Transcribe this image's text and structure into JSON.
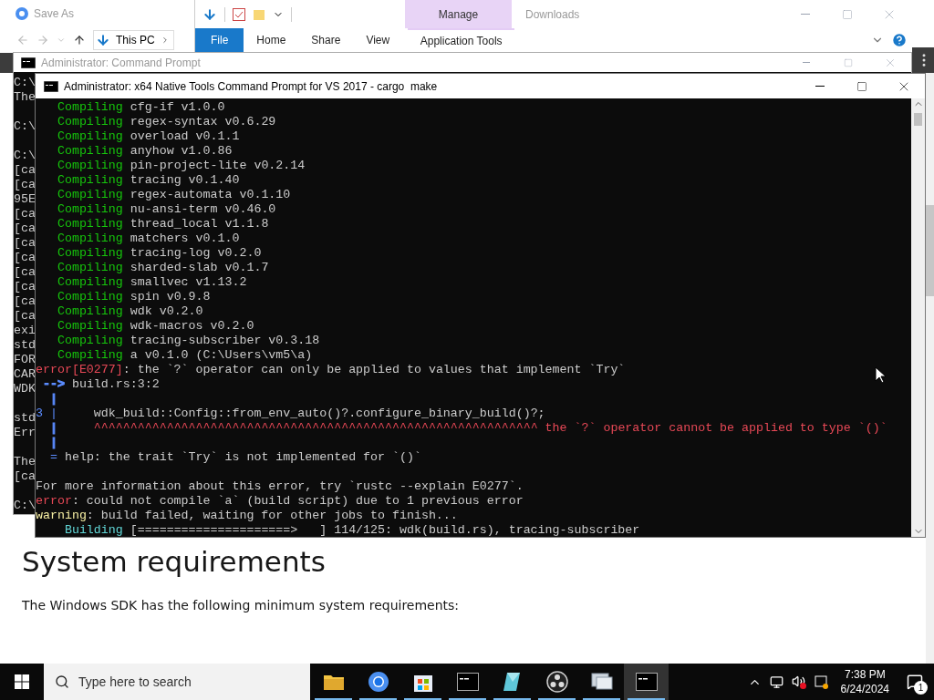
{
  "browser": {
    "heading": "System requirements",
    "paragraph": "The Windows SDK has the following minimum system requirements:"
  },
  "save_as_dialog": {
    "title": "Save As",
    "path": [
      "This PC"
    ]
  },
  "explorer": {
    "title": "Downloads",
    "context_tab": "Manage",
    "ribbon_tabs": [
      {
        "label": "File",
        "kind": "file"
      },
      {
        "label": "Home",
        "kind": "tab"
      },
      {
        "label": "Share",
        "kind": "tab"
      },
      {
        "label": "View",
        "kind": "tab"
      },
      {
        "label": "Application Tools",
        "kind": "context"
      }
    ]
  },
  "background_cmd": {
    "title": "Administrator: Command Prompt",
    "lines": [
      {
        "kind": "text",
        "text": "C:\\"
      },
      {
        "kind": "text",
        "text": "The"
      },
      {
        "kind": "blank"
      },
      {
        "kind": "text",
        "text": "C:\\"
      },
      {
        "kind": "blank"
      },
      {
        "kind": "text",
        "text": "C:\\"
      },
      {
        "kind": "text",
        "text": "[ca"
      },
      {
        "kind": "text",
        "text": "[ca"
      },
      {
        "kind": "text",
        "text": "95E"
      },
      {
        "kind": "text",
        "text": "[ca"
      },
      {
        "kind": "text",
        "text": "[ca"
      },
      {
        "kind": "text",
        "text": "[ca"
      },
      {
        "kind": "text",
        "text": "[ca"
      },
      {
        "kind": "text",
        "text": "[ca"
      },
      {
        "kind": "text",
        "text": "[ca"
      },
      {
        "kind": "text",
        "text": "[ca"
      },
      {
        "kind": "text",
        "text": "[ca"
      },
      {
        "kind": "text",
        "text": "exi"
      },
      {
        "kind": "text",
        "text": "std"
      },
      {
        "kind": "text",
        "text": "FOR"
      },
      {
        "kind": "text",
        "text": "CAR"
      },
      {
        "kind": "text",
        "text": "WDK"
      },
      {
        "kind": "blank"
      },
      {
        "kind": "text",
        "text": "std"
      },
      {
        "kind": "text",
        "text": "Err"
      },
      {
        "kind": "blank"
      },
      {
        "kind": "text",
        "text": "The"
      },
      {
        "kind": "text",
        "text": "[ca"
      },
      {
        "kind": "blank"
      },
      {
        "kind": "text",
        "text": "C:\\"
      }
    ]
  },
  "terminal": {
    "title": "Administrator: x64 Native Tools Command Prompt for VS 2017 - cargo  make",
    "lines": [
      {
        "kind": "text",
        "segments": [
          {
            "text": "   Compiling",
            "color": "#16c60c"
          },
          {
            "text": " cfg-if v1.0.0",
            "color": "#cccccc"
          }
        ]
      },
      {
        "kind": "text",
        "segments": [
          {
            "text": "   Compiling",
            "color": "#16c60c"
          },
          {
            "text": " regex-syntax v0.6.29",
            "color": "#cccccc"
          }
        ]
      },
      {
        "kind": "text",
        "segments": [
          {
            "text": "   Compiling",
            "color": "#16c60c"
          },
          {
            "text": " overload v0.1.1",
            "color": "#cccccc"
          }
        ]
      },
      {
        "kind": "text",
        "segments": [
          {
            "text": "   Compiling",
            "color": "#16c60c"
          },
          {
            "text": " anyhow v1.0.86",
            "color": "#cccccc"
          }
        ]
      },
      {
        "kind": "text",
        "segments": [
          {
            "text": "   Compiling",
            "color": "#16c60c"
          },
          {
            "text": " pin-project-lite v0.2.14",
            "color": "#cccccc"
          }
        ]
      },
      {
        "kind": "text",
        "segments": [
          {
            "text": "   Compiling",
            "color": "#16c60c"
          },
          {
            "text": " tracing v0.1.40",
            "color": "#cccccc"
          }
        ]
      },
      {
        "kind": "text",
        "segments": [
          {
            "text": "   Compiling",
            "color": "#16c60c"
          },
          {
            "text": " regex-automata v0.1.10",
            "color": "#cccccc"
          }
        ]
      },
      {
        "kind": "text",
        "segments": [
          {
            "text": "   Compiling",
            "color": "#16c60c"
          },
          {
            "text": " nu-ansi-term v0.46.0",
            "color": "#cccccc"
          }
        ]
      },
      {
        "kind": "text",
        "segments": [
          {
            "text": "   Compiling",
            "color": "#16c60c"
          },
          {
            "text": " thread_local v1.1.8",
            "color": "#cccccc"
          }
        ]
      },
      {
        "kind": "text",
        "segments": [
          {
            "text": "   Compiling",
            "color": "#16c60c"
          },
          {
            "text": " matchers v0.1.0",
            "color": "#cccccc"
          }
        ]
      },
      {
        "kind": "text",
        "segments": [
          {
            "text": "   Compiling",
            "color": "#16c60c"
          },
          {
            "text": " tracing-log v0.2.0",
            "color": "#cccccc"
          }
        ]
      },
      {
        "kind": "text",
        "segments": [
          {
            "text": "   Compiling",
            "color": "#16c60c"
          },
          {
            "text": " sharded-slab v0.1.7",
            "color": "#cccccc"
          }
        ]
      },
      {
        "kind": "text",
        "segments": [
          {
            "text": "   Compiling",
            "color": "#16c60c"
          },
          {
            "text": " smallvec v1.13.2",
            "color": "#cccccc"
          }
        ]
      },
      {
        "kind": "text",
        "segments": [
          {
            "text": "   Compiling",
            "color": "#16c60c"
          },
          {
            "text": " spin v0.9.8",
            "color": "#cccccc"
          }
        ]
      },
      {
        "kind": "text",
        "segments": [
          {
            "text": "   Compiling",
            "color": "#16c60c"
          },
          {
            "text": " wdk v0.2.0",
            "color": "#cccccc"
          }
        ]
      },
      {
        "kind": "text",
        "segments": [
          {
            "text": "   Compiling",
            "color": "#16c60c"
          },
          {
            "text": " wdk-macros v0.2.0",
            "color": "#cccccc"
          }
        ]
      },
      {
        "kind": "text",
        "segments": [
          {
            "text": "   Compiling",
            "color": "#16c60c"
          },
          {
            "text": " tracing-subscriber v0.3.18",
            "color": "#cccccc"
          }
        ]
      },
      {
        "kind": "text",
        "segments": [
          {
            "text": "   Compiling",
            "color": "#16c60c"
          },
          {
            "text": " a v0.1.0 (C:\\Users\\vm5\\a)",
            "color": "#cccccc"
          }
        ]
      },
      {
        "kind": "text",
        "segments": [
          {
            "text": "error[E0277]",
            "color": "#e74856"
          },
          {
            "text": ": the `?` operator can only be applied to values that implement `Try`",
            "color": "#cccccc"
          }
        ]
      },
      {
        "kind": "text",
        "segments": [
          {
            "text": " -->",
            "color": "#5b8cff",
            "bold": true
          },
          {
            "text": " build.rs:3:2",
            "color": "#cccccc"
          }
        ]
      },
      {
        "kind": "text",
        "segments": [
          {
            "text": "  |",
            "color": "#5b8cff",
            "bold": true
          }
        ]
      },
      {
        "kind": "text",
        "segments": [
          {
            "text": "3 |",
            "color": "#5b8cff"
          },
          {
            "text": "     wdk_build::Config::from_env_auto()?.configure_binary_build()?;",
            "color": "#cccccc"
          }
        ]
      },
      {
        "kind": "text",
        "segments": [
          {
            "text": "  |",
            "color": "#5b8cff",
            "bold": true
          },
          {
            "text": "     ^^^^^^^^^^^^^^^^^^^^^^^^^^^^^^^^^^^^^^^^^^^^^^^^^^^^^^^^^^^^^ the `?` operator cannot be applied to type `()`",
            "color": "#e74856"
          }
        ]
      },
      {
        "kind": "text",
        "segments": [
          {
            "text": "  |",
            "color": "#5b8cff",
            "bold": true
          }
        ]
      },
      {
        "kind": "text",
        "segments": [
          {
            "text": "  =",
            "color": "#5b8cff"
          },
          {
            "text": " help: the trait `Try` is not implemented for `()`",
            "color": "#cccccc"
          }
        ]
      },
      {
        "kind": "blank"
      },
      {
        "kind": "text",
        "segments": [
          {
            "text": "For more information about this error, try `rustc --explain E0277`.",
            "color": "#cccccc"
          }
        ]
      },
      {
        "kind": "text",
        "segments": [
          {
            "text": "error",
            "color": "#e74856"
          },
          {
            "text": ": could not compile `a` (build script) due to 1 previous error",
            "color": "#cccccc"
          }
        ]
      },
      {
        "kind": "text",
        "segments": [
          {
            "text": "warning",
            "color": "#f9f1a5"
          },
          {
            "text": ": build failed, waiting for other jobs to finish...",
            "color": "#cccccc"
          }
        ]
      },
      {
        "kind": "text",
        "segments": [
          {
            "text": "    Building",
            "color": "#61d6d6"
          },
          {
            "text": " [=====================>   ] 114/125: wdk(build.rs), tracing-subscriber",
            "color": "#cccccc"
          }
        ]
      }
    ]
  },
  "taskbar": {
    "search_placeholder": "Type here to search",
    "apps": [
      {
        "kind": "folder",
        "selected": false,
        "running": true
      },
      {
        "kind": "browser",
        "selected": false,
        "running": true
      },
      {
        "kind": "store",
        "selected": false,
        "running": true
      },
      {
        "kind": "terminal",
        "selected": false,
        "running": true
      },
      {
        "kind": "crystal",
        "selected": false,
        "running": true
      },
      {
        "kind": "aperture",
        "selected": false,
        "running": true
      },
      {
        "kind": "monitor",
        "selected": false,
        "running": true
      },
      {
        "kind": "terminal",
        "selected": true,
        "running": true
      }
    ],
    "time": "7:38 PM",
    "date": "6/24/2024",
    "notification_count": "1"
  }
}
